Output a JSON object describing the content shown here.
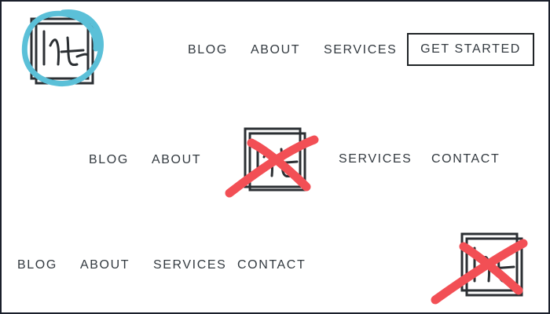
{
  "variant_top": {
    "nav": [
      "BLOG",
      "ABOUT",
      "SERVICES"
    ],
    "cta_label": "GET STARTED",
    "logo_icon": "ht-monogram-logo-icon",
    "annotation": "circle-highlight-icon"
  },
  "variant_middle": {
    "nav_left": [
      "BLOG",
      "ABOUT"
    ],
    "nav_right": [
      "SERVICES",
      "CONTACT"
    ],
    "logo_icon": "ht-monogram-logo-icon",
    "annotation": "x-mark-icon"
  },
  "variant_bottom": {
    "nav": [
      "BLOG",
      "ABOUT",
      "SERVICES",
      "CONTACT"
    ],
    "logo_icon": "ht-monogram-logo-icon",
    "annotation": "x-mark-icon"
  },
  "colors": {
    "circle_highlight": "#5bc0d8",
    "x_mark": "#f24f55",
    "logo_ink": "#2b2f33",
    "text": "#333a40",
    "frame": "#1a1f2b"
  }
}
